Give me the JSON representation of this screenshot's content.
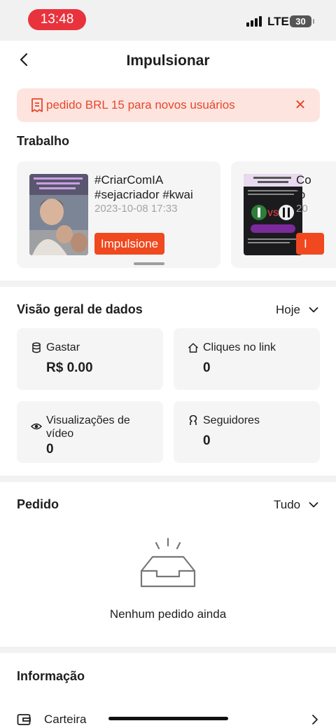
{
  "status_bar": {
    "time": "13:48",
    "network": "LTE",
    "battery": "30"
  },
  "header": {
    "title": "Impulsionar"
  },
  "banner": {
    "text": "pedido BRL 15 para novos usuários"
  },
  "works": {
    "title": "Trabalho",
    "items": [
      {
        "caption_line1": "#CriarComIA",
        "caption_line2": "#sejacriador #kwai",
        "date": "2023-10-08 17:33",
        "button": "Impulsione"
      },
      {
        "caption_line1": "Co",
        "caption_line2": "jo",
        "date": "20",
        "button": "I"
      }
    ]
  },
  "overview": {
    "title": "Visão geral de dados",
    "period": "Hoje",
    "stats": [
      {
        "label": "Gastar",
        "value": "R$ 0.00",
        "icon": "database-icon"
      },
      {
        "label": "Cliques no link",
        "value": "0",
        "icon": "home-icon"
      },
      {
        "label_line1": "Visualizações de",
        "label_line2": "vídeo",
        "value": "0",
        "icon": "eye-icon"
      },
      {
        "label": "Seguidores",
        "value": "0",
        "icon": "person-icon"
      }
    ]
  },
  "orders": {
    "title": "Pedido",
    "filter": "Tudo",
    "empty_text": "Nenhum pedido ainda"
  },
  "info": {
    "title": "Informação",
    "wallet_label": "Carteira"
  },
  "colors": {
    "accent": "#f0481f",
    "banner_bg": "#fde4df",
    "banner_text": "#e5482d",
    "time_pill": "#e8333d"
  }
}
